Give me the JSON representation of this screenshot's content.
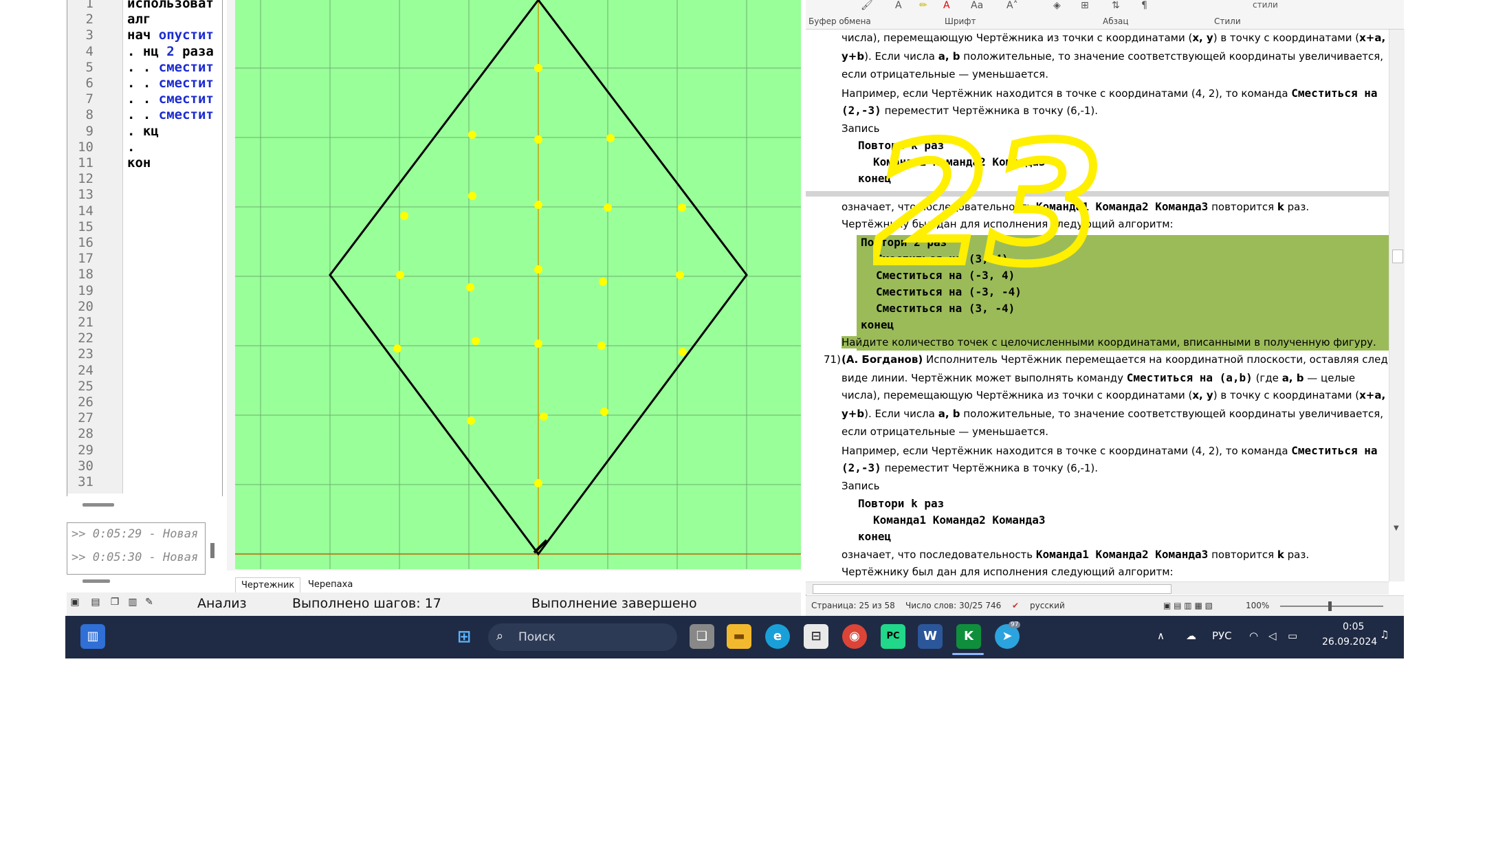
{
  "editor": {
    "line_numbers": [
      "1",
      "2",
      "3",
      "4",
      "5",
      "6",
      "7",
      "8",
      "9",
      "10",
      "11",
      "12",
      "13",
      "14",
      "15",
      "16",
      "17",
      "18",
      "19",
      "20",
      "21",
      "22",
      "23",
      "24",
      "25",
      "26",
      "27",
      "28",
      "29",
      "30",
      "31"
    ],
    "lines": [
      {
        "plain": "использоват",
        "kw": ""
      },
      {
        "plain": "алг",
        "kw": ""
      },
      {
        "plain": "нач ",
        "kw": "опустит"
      },
      {
        "plain": ". нц ",
        "kw": "2",
        "tail": " раза"
      },
      {
        "plain": ". . ",
        "kw": "сместит"
      },
      {
        "plain": ". . ",
        "kw": "сместит"
      },
      {
        "plain": ". . ",
        "kw": "сместит"
      },
      {
        "plain": ". . ",
        "kw": "сместит"
      },
      {
        "plain": ". кц",
        "kw": ""
      },
      {
        "plain": ".",
        "kw": ""
      },
      {
        "plain": "кон",
        "kw": ""
      }
    ]
  },
  "messages": [
    ">> 0:05:29 - Новая",
    ">> 0:05:30 - Новая"
  ],
  "canvas_tabs": [
    "Чертежник",
    "Черепаха"
  ],
  "status": {
    "analysis": "Анализ",
    "steps": "Выполнено шагов: 17",
    "result": "Выполнение завершено"
  },
  "drawing": {
    "background": "#99ff99",
    "grid_color": "#6bb06b",
    "axis_color": "#c8a000",
    "line_color": "#000000",
    "dot_color": "#ffff00",
    "annotation": "23",
    "annotation_color": "#ffef00"
  },
  "word": {
    "ribbon_groups": [
      "Буфер обмена",
      "Шрифт",
      "Абзац",
      "Стили"
    ],
    "styles_label": "стили",
    "doc": {
      "p1a": "числа), перемещающую  Чертёжника из точки с координатами (",
      "p1b": "x, y",
      "p1c": ") в точку с координатами (",
      "p1d": "x+a,",
      "p2a": "y+b",
      "p2b": "). Если числа ",
      "p2c": "a, b",
      "p2d": " положительные, то значение соответствующей координаты увеличивается,",
      "p3": "если отрицательные — уменьшается.",
      "p4a": "Например, если Чертёжник находится в точке с координатами (4, 2), то команда ",
      "p4b": "Сместиться на",
      "p5a": "(2,-3)",
      "p5b": " переместит Чертёжника в точку (6,-1).",
      "p6": "Запись",
      "c1": "Повтори k раз",
      "c2": "Команда1 Команда2 Команда3",
      "c3": "конец",
      "q1a": "означает, что последовательность ",
      "q1b": "Команда1 Команда2 Команда3",
      "q1c": " повторится ",
      "q1d": "k",
      "q1e": " раз.",
      "q2": "Чертёжнику был дан для исполнения следующий алгоритм:",
      "a1": "Повтори 2 раз",
      "a2": "Сместиться на (3, 4)",
      "a3": "Сместиться на (-3, 4)",
      "a4": "Сместиться на (-3, -4)",
      "a5": "Сместиться на (3, -4)",
      "a6": "конец",
      "q3": "Найдите количество точек с целочисленными координатами, вписанными в полученную фигуру.",
      "n71": "71)",
      "r1a": "(А. Богданов)",
      "r1b": " Исполнитель Чертёжник перемещается на координатной плоскости, оставляя след в",
      "r2a": "виде линии. Чертёжник может выполнять команду ",
      "r2b": "Сместиться на (a,b)",
      "r2c": " (где ",
      "r2d": "a, b",
      "r2e": " — целые",
      "r6": "Запись",
      "s1": "означает, что последовательность ",
      "s2": "Команда1 Команда2 Команда3",
      "s3": " повторится ",
      "s4": "k",
      "s5": " раз.",
      "s6": "Чертёжнику был дан для исполнения следующий алгоритм:"
    },
    "statusbar": {
      "page": "Страница: 25 из 58",
      "words": "Число слов: 30/25 746",
      "lang": "русский",
      "zoom": "100%"
    }
  },
  "taskbar": {
    "search_placeholder": "Поиск",
    "lang": "РУС",
    "time": "0:05",
    "date": "26.09.2024",
    "telegram_badge": "97"
  }
}
